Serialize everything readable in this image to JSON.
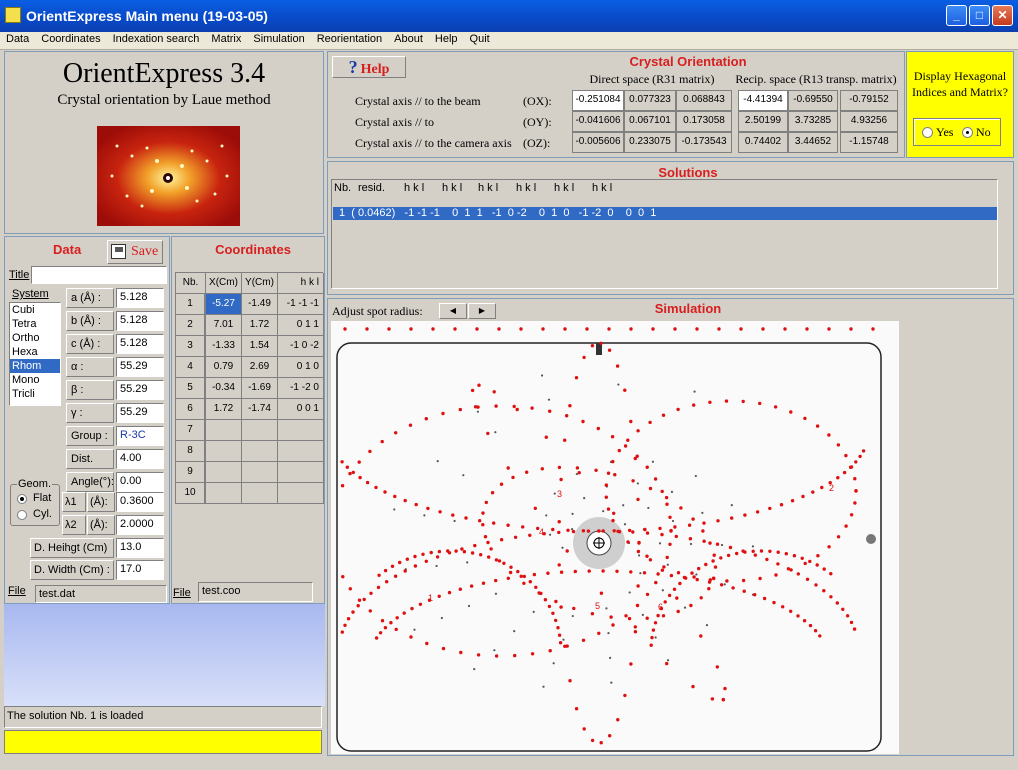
{
  "window": {
    "title": "OrientExpress Main menu (19-03-05)"
  },
  "menu": [
    "Data",
    "Coordinates",
    "Indexation search",
    "Matrix",
    "Simulation",
    "Reorientation",
    "About",
    "Help",
    "Quit"
  ],
  "app": {
    "name": "OrientExpress 3.4",
    "subtitle": "Crystal orientation by Laue method"
  },
  "help_button": "Help",
  "crystal_orientation": {
    "title": "Crystal Orientation",
    "direct_header": "Direct space (R31 matrix)",
    "recip_header": "Recip. space (R13 transp. matrix)",
    "rows": [
      {
        "label": "Crystal axis // to the beam",
        "axis": "(OX):",
        "direct": [
          "-0.251084",
          "0.077323",
          "0.068843"
        ],
        "recip": [
          "-4.41394",
          "-0.69550",
          "-0.79152"
        ]
      },
      {
        "label": "Crystal axis // to",
        "axis": "(OY):",
        "direct": [
          "-0.041606",
          "0.067101",
          "0.173058"
        ],
        "recip": [
          "2.50199",
          "3.73285",
          "4.93256"
        ]
      },
      {
        "label": "Crystal axis // to the camera axis",
        "axis": "(OZ):",
        "direct": [
          "-0.005606",
          "0.233075",
          "-0.173543"
        ],
        "recip": [
          "0.74402",
          "3.44652",
          "-1.15748"
        ]
      }
    ]
  },
  "hexagonal": {
    "question": "Display Hexagonal Indices and Matrix?",
    "yes": "Yes",
    "no": "No"
  },
  "solutions": {
    "title": "Solutions",
    "header": [
      "Nb.",
      "resid.",
      "h k l",
      "h k l",
      "h k l",
      "h k l",
      "h k l",
      "h k l"
    ],
    "row": "1  ( 0.0462)   -1 -1 -1    0  1  1   -1  0 -2    0  1  0   -1 -2  0    0  0  1"
  },
  "data_panel": {
    "title": "Data",
    "save": "Save",
    "title_label": "Title",
    "system_label": "System",
    "systems": [
      "Cubi",
      "Tetra",
      "Ortho",
      "Hexa",
      "Rhom",
      "Mono",
      "Tricli"
    ],
    "selected_system": "Rhom",
    "params": [
      {
        "label": "a (Å) :",
        "value": "5.128"
      },
      {
        "label": "b (Å) :",
        "value": "5.128"
      },
      {
        "label": "c (Å) :",
        "value": "5.128"
      },
      {
        "label": "α :",
        "value": "55.29"
      },
      {
        "label": "β :",
        "value": "55.29"
      },
      {
        "label": "γ :",
        "value": "55.29"
      },
      {
        "label": "Group :",
        "value": "R-3C"
      },
      {
        "label": "Dist.(Cm)",
        "value": "4.00"
      },
      {
        "label": "Angle(°):",
        "value": "0.00"
      }
    ],
    "geom_label": "Geom.",
    "geom_flat": "Flat",
    "geom_cyl": "Cyl.",
    "lambda1_label": "λ1",
    "lambda2_label": "λ2",
    "lambda_unit": "(Å):",
    "lambda1": "0.3600",
    "lambda2": "2.0000",
    "heihgt_label": "D. Heihgt  (Cm) :",
    "heihgt": "13.0",
    "width_label": "D. Width (Cm) :",
    "width": "17.0",
    "file_label": "File",
    "file": "test.dat"
  },
  "coordinates": {
    "title": "Coordinates",
    "headers": [
      "Nb.",
      "X(Cm)",
      "Y(Cm)",
      "h  k  l"
    ],
    "rows": [
      [
        "1",
        "-5.27",
        "-1.49",
        "-1 -1 -1"
      ],
      [
        "2",
        "7.01",
        "1.72",
        "0  1  1"
      ],
      [
        "3",
        "-1.33",
        "1.54",
        "-1  0 -2"
      ],
      [
        "4",
        "0.79",
        "2.69",
        "0  1  0"
      ],
      [
        "5",
        "-0.34",
        "-1.69",
        "-1 -2  0"
      ],
      [
        "6",
        "1.72",
        "-1.74",
        "0  0  1"
      ],
      [
        "7",
        "",
        "",
        ""
      ],
      [
        "8",
        "",
        "",
        ""
      ],
      [
        "9",
        "",
        "",
        ""
      ],
      [
        "10",
        "",
        "",
        ""
      ]
    ],
    "file_label": "File",
    "file": "test.coo"
  },
  "simulation": {
    "title": "Simulation",
    "adjust_label": "Adjust spot radius:",
    "spot_labels": [
      "1",
      "2",
      "3",
      "4",
      "5",
      "6"
    ]
  },
  "status": "The solution Nb. 1 is loaded",
  "colors": {
    "accent_red": "#d81e1e",
    "yellow": "#ffff00",
    "selection": "#316ac5"
  }
}
